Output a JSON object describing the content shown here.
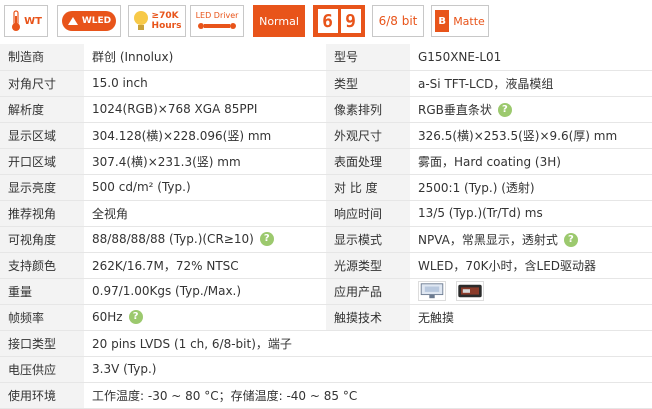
{
  "badges": {
    "wt": "WT",
    "wled": "WLED",
    "hours_line1": "≥70K",
    "hours_line2": "Hours",
    "driver": "LED Driver",
    "normal": "Normal",
    "digit1": "6",
    "digit2": "9",
    "bit": "6/8 bit",
    "matte_letter": "B",
    "matte": "Matte"
  },
  "rows": [
    {
      "k": "制造商",
      "v": "群创 (Innolux)",
      "k2": "型号",
      "v2": "G150XNE-L01"
    },
    {
      "k": "对角尺寸",
      "v": "15.0 inch",
      "k2": "类型",
      "v2": "a-Si TFT-LCD，液晶模组"
    },
    {
      "k": "解析度",
      "v": "1024(RGB)×768   XGA   85PPI",
      "k2": "像素排列",
      "v2": "RGB垂直条状"
    },
    {
      "k": "显示区域",
      "v": "304.128(横)×228.096(竖) mm",
      "k2": "外观尺寸",
      "v2": "326.5(横)×253.5(竖)×9.6(厚) mm"
    },
    {
      "k": "开口区域",
      "v": "307.4(横)×231.3(竖) mm",
      "k2": "表面处理",
      "v2": "雾面，Hard coating (3H)"
    },
    {
      "k": "显示亮度",
      "v": "500 cd/m² (Typ.)",
      "k2": "对 比 度",
      "v2": "2500:1 (Typ.) (透射)"
    },
    {
      "k": "推荐视角",
      "v": "全视角",
      "k2": "响应时间",
      "v2": "13/5 (Typ.)(Tr/Td) ms"
    },
    {
      "k": "可视角度",
      "v": "88/88/88/88 (Typ.)(CR≥10)",
      "k2": "显示模式",
      "v2": "NPVA，常黑显示，透射式"
    },
    {
      "k": "支持颜色",
      "v": "262K/16.7M，72% NTSC",
      "k2": "光源类型",
      "v2": "WLED，70K小时，含LED驱动器"
    },
    {
      "k": "重量",
      "v": "0.97/1.00Kgs (Typ./Max.)",
      "k2": "应用产品",
      "v2": ""
    },
    {
      "k": "帧频率",
      "v": "60Hz",
      "k2": "触摸技术",
      "v2": "无触摸"
    },
    {
      "k": "接口类型",
      "v": "20 pins   LVDS (1 ch, 6/8-bit)，端子"
    },
    {
      "k": "电压供应",
      "v": "3.3V (Typ.)"
    },
    {
      "k": "使用环境",
      "v": "工作温度: -30 ~ 80 °C；存储温度: -40 ~ 85 °C"
    }
  ],
  "help_glyph": "?",
  "colors": {
    "accent": "#e8541a",
    "help": "#9cc96e",
    "label_bg": "#f3f3f3"
  }
}
